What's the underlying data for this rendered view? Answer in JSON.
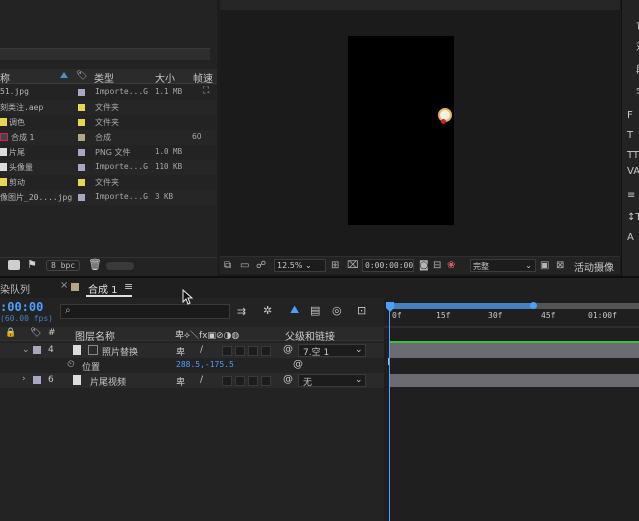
{
  "project": {
    "columns": {
      "name": "称",
      "type": "类型",
      "size": "大小",
      "rate": "帧速"
    },
    "rows": [
      {
        "name": "51.jpg",
        "type": "Importe...G",
        "size": "1.1 MB",
        "color": "#a7a6c3"
      },
      {
        "name": "刻类注.aep",
        "type": "文件夹",
        "size": "",
        "color": "#e8d64f"
      },
      {
        "name": "调色",
        "type": "文件夹",
        "size": "",
        "color": "#e8d64f"
      },
      {
        "name": "合成 1",
        "type": "合成",
        "size": "60",
        "color": "#b5a582"
      },
      {
        "name": "片尾",
        "type": "PNG 文件",
        "size": "1.0 MB",
        "color": "#a7a6c3"
      },
      {
        "name": "头像量",
        "type": "Importe...G",
        "size": "110 KB",
        "color": "#a7a6c3"
      },
      {
        "name": "剪动",
        "type": "文件夹",
        "size": "",
        "color": "#e8d64f"
      },
      {
        "name": "像图片_20....jpg",
        "type": "Importe...G",
        "size": "3 KB",
        "color": "#a7a6c3"
      }
    ],
    "bpc": "8 bpc"
  },
  "viewer": {
    "zoom": "12.5%",
    "timecode": "0:00:00:00",
    "resolution": "完整",
    "camera": "活动摄像"
  },
  "right_panel": {
    "chars": [
      "亡",
      "对",
      "段",
      "字"
    ],
    "symbols": [
      "F",
      "T",
      "TT",
      "VA",
      "≡",
      "↕T",
      "A"
    ]
  },
  "timeline": {
    "tabs": {
      "render_queue": "染队列",
      "comp": "合成 1"
    },
    "current_time": ":00:00",
    "fps": "(60.00 fps)",
    "search_placeholder": "",
    "columns": {
      "layer_name": "图层名称",
      "parent": "父级和链接"
    },
    "layers": [
      {
        "num": "4",
        "name": "照片替换",
        "parent": "7.空 1",
        "color": "#a7a6c3"
      },
      {
        "num": "6",
        "name": "片尾视频",
        "parent": "无",
        "color": "#a7a6c3"
      }
    ],
    "position_label": "位置",
    "position_value": "288.5,-175.5",
    "ruler": [
      "0f",
      "15f",
      "30f",
      "45f",
      "01:00f"
    ]
  }
}
